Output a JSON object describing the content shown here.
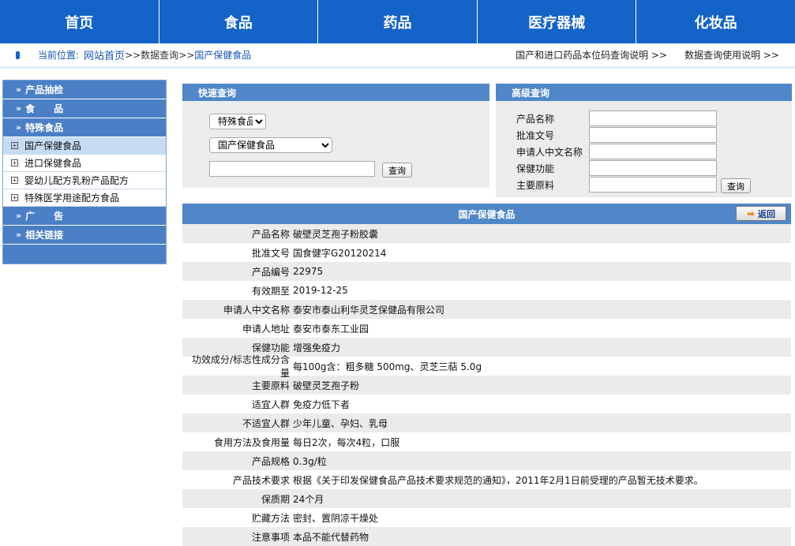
{
  "nav": {
    "items": [
      "首页",
      "食品",
      "药品",
      "医疗器械",
      "化妆品"
    ]
  },
  "breadcrumb": {
    "prefix": "当前位置:",
    "home": "网站首页",
    "sep1": ">>",
    "level2": "数据查询",
    "sep2": ">>",
    "current": "国产保健食品",
    "right_link_1": "国产和进口药品本位码查询说明 >>",
    "right_link_2": "数据查询使用说明 >>"
  },
  "sidebar": {
    "sections": [
      {
        "label": "产品抽检"
      },
      {
        "label": "食　　品"
      },
      {
        "label": "特殊食品"
      }
    ],
    "subitems": [
      {
        "label": "国产保健食品"
      },
      {
        "label": "进口保健食品"
      },
      {
        "label": "婴幼儿配方乳粉产品配方"
      },
      {
        "label": "特殊医学用途配方食品"
      }
    ],
    "bottom_sections": [
      {
        "label": "广　　告"
      },
      {
        "label": "相关链接"
      }
    ]
  },
  "quick_search": {
    "title": "快速查询",
    "category_select": "特殊食品",
    "subcategory_select": "国产保健食品",
    "keyword_value": "",
    "search_button": "查询"
  },
  "advanced_search": {
    "title": "高级查询",
    "fields": [
      {
        "label": "产品名称",
        "value": ""
      },
      {
        "label": "批准文号",
        "value": ""
      },
      {
        "label": "申请人中文名称",
        "value": ""
      },
      {
        "label": "保健功能",
        "value": ""
      },
      {
        "label": "主要原料",
        "value": ""
      }
    ],
    "search_button": "查询"
  },
  "detail": {
    "title": "国产保健食品",
    "back_label": "返回",
    "rows": [
      {
        "label": "产品名称",
        "value": "破壁灵芝孢子粉胶囊"
      },
      {
        "label": "批准文号",
        "value": "国食健字G20120214"
      },
      {
        "label": "产品编号",
        "value": "22975"
      },
      {
        "label": "有效期至",
        "value": "2019-12-25"
      },
      {
        "label": "申请人中文名称",
        "value": "泰安市泰山利华灵芝保健品有限公司"
      },
      {
        "label": "申请人地址",
        "value": "泰安市泰东工业园"
      },
      {
        "label": "保健功能",
        "value": "增强免疫力"
      },
      {
        "label": "功效成分/标志性成分含量",
        "value": "每100g含：粗多糖 500mg、灵芝三萜 5.0g"
      },
      {
        "label": "主要原料",
        "value": "破壁灵芝孢子粉"
      },
      {
        "label": "适宜人群",
        "value": "免疫力低下者"
      },
      {
        "label": "不适宜人群",
        "value": "少年儿童、孕妇、乳母"
      },
      {
        "label": "食用方法及食用量",
        "value": "每日2次，每次4粒，口服"
      },
      {
        "label": "产品规格",
        "value": "0.3g/粒"
      },
      {
        "label": "产品技术要求",
        "value": "根据《关于印发保健食品产品技术要求规范的通知》，2011年2月1日前受理的产品暂无技术要求。"
      },
      {
        "label": "保质期",
        "value": "24个月"
      },
      {
        "label": "贮藏方法",
        "value": "密封、置阴凉干燥处"
      },
      {
        "label": "注意事项",
        "value": "本品不能代替药物"
      }
    ]
  }
}
